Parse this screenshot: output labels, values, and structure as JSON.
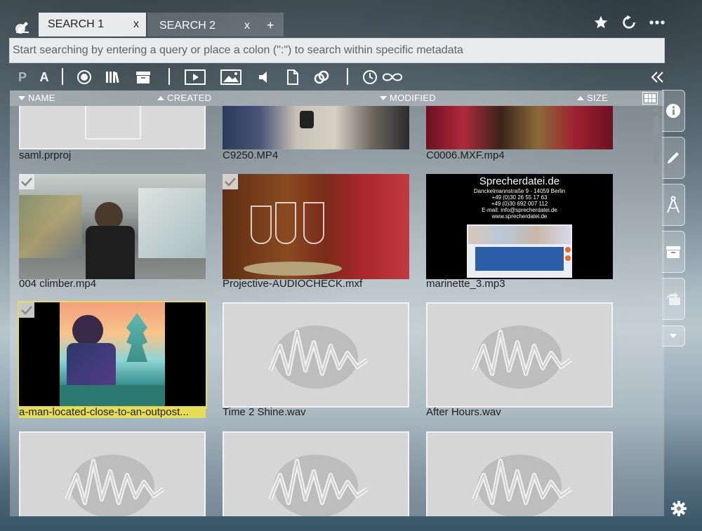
{
  "tabs": [
    {
      "label": "SEARCH 1",
      "close": "x"
    },
    {
      "label": "SEARCH 2",
      "close": "x"
    }
  ],
  "tab_add": "+",
  "search": {
    "placeholder": "Start searching by entering a query or place a colon (\":\") to search within specific metadata"
  },
  "toolbar": {
    "p_label": "P",
    "a_label": "A"
  },
  "columns": {
    "name": "NAME",
    "created": "CREATED",
    "modified": "MODIFIED",
    "size": "SIZE"
  },
  "items": [
    {
      "name": "saml.prproj",
      "kind": "project",
      "checked": false
    },
    {
      "name": "C9250.MP4",
      "kind": "video",
      "checked": false
    },
    {
      "name": "C0006.MXF.mp4",
      "kind": "video",
      "checked": false
    },
    {
      "name": "004 climber.mp4",
      "kind": "video",
      "checked": true
    },
    {
      "name": "Projective-AUDIOCHECK.mxf",
      "kind": "video",
      "checked": true
    },
    {
      "name": "marinette_3.mp3",
      "kind": "audio",
      "checked": false
    },
    {
      "name": "a-man-located-close-to-an-outpost...",
      "kind": "image",
      "checked": true,
      "selected": true
    },
    {
      "name": "Time 2 Shine.wav",
      "kind": "audio",
      "checked": false
    },
    {
      "name": "After Hours.wav",
      "kind": "audio",
      "checked": false
    },
    {
      "name": "",
      "kind": "audio",
      "checked": false
    },
    {
      "name": "",
      "kind": "audio",
      "checked": false
    },
    {
      "name": "",
      "kind": "audio",
      "checked": false
    }
  ],
  "sprecher": {
    "title": "Sprecherdatei.de",
    "lines": [
      "Danckelmannstraße 9 - 14059 Berlin",
      "+49 (0)30 26 55 17 63",
      "+49 (0)30 692 007 112",
      "E-mail: info@sprecherdatei.de",
      "www.sprecherdatei.de"
    ]
  },
  "colors": {
    "selection": "#e7dc55",
    "tile_bg": "#d6d6d6"
  }
}
